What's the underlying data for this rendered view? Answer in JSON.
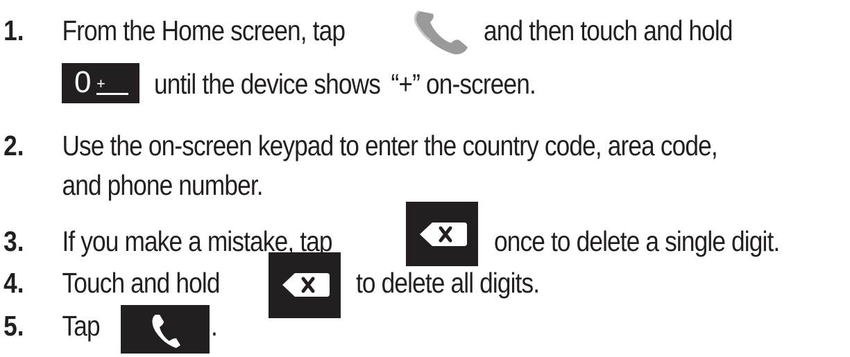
{
  "steps": [
    {
      "number": "1.",
      "parts": [
        "From the Home screen, tap",
        "and then touch and hold",
        "until the device shows",
        "“+” on-screen."
      ],
      "icons": [
        "phone-app-icon",
        "zero-plus-key-icon"
      ]
    },
    {
      "number": "2.",
      "parts": [
        "Use the on-screen keypad to enter the country code, area code,",
        "and phone number."
      ]
    },
    {
      "number": "3.",
      "parts": [
        "If you make a mistake, tap",
        "once to delete a single digit."
      ],
      "icons": [
        "backspace-key-icon"
      ]
    },
    {
      "number": "4.",
      "parts": [
        "Touch and hold",
        "to delete all digits."
      ],
      "icons": [
        "backspace-key-icon"
      ]
    },
    {
      "number": "5.",
      "parts": [
        "Tap",
        "."
      ],
      "icons": [
        "call-button-icon"
      ]
    }
  ],
  "key_labels": {
    "zero": "0",
    "plus": "+"
  },
  "colors": {
    "text": "#231f20",
    "key_background": "#231f20",
    "key_foreground": "#ffffff",
    "phone_icon": "#9a9a9a"
  }
}
